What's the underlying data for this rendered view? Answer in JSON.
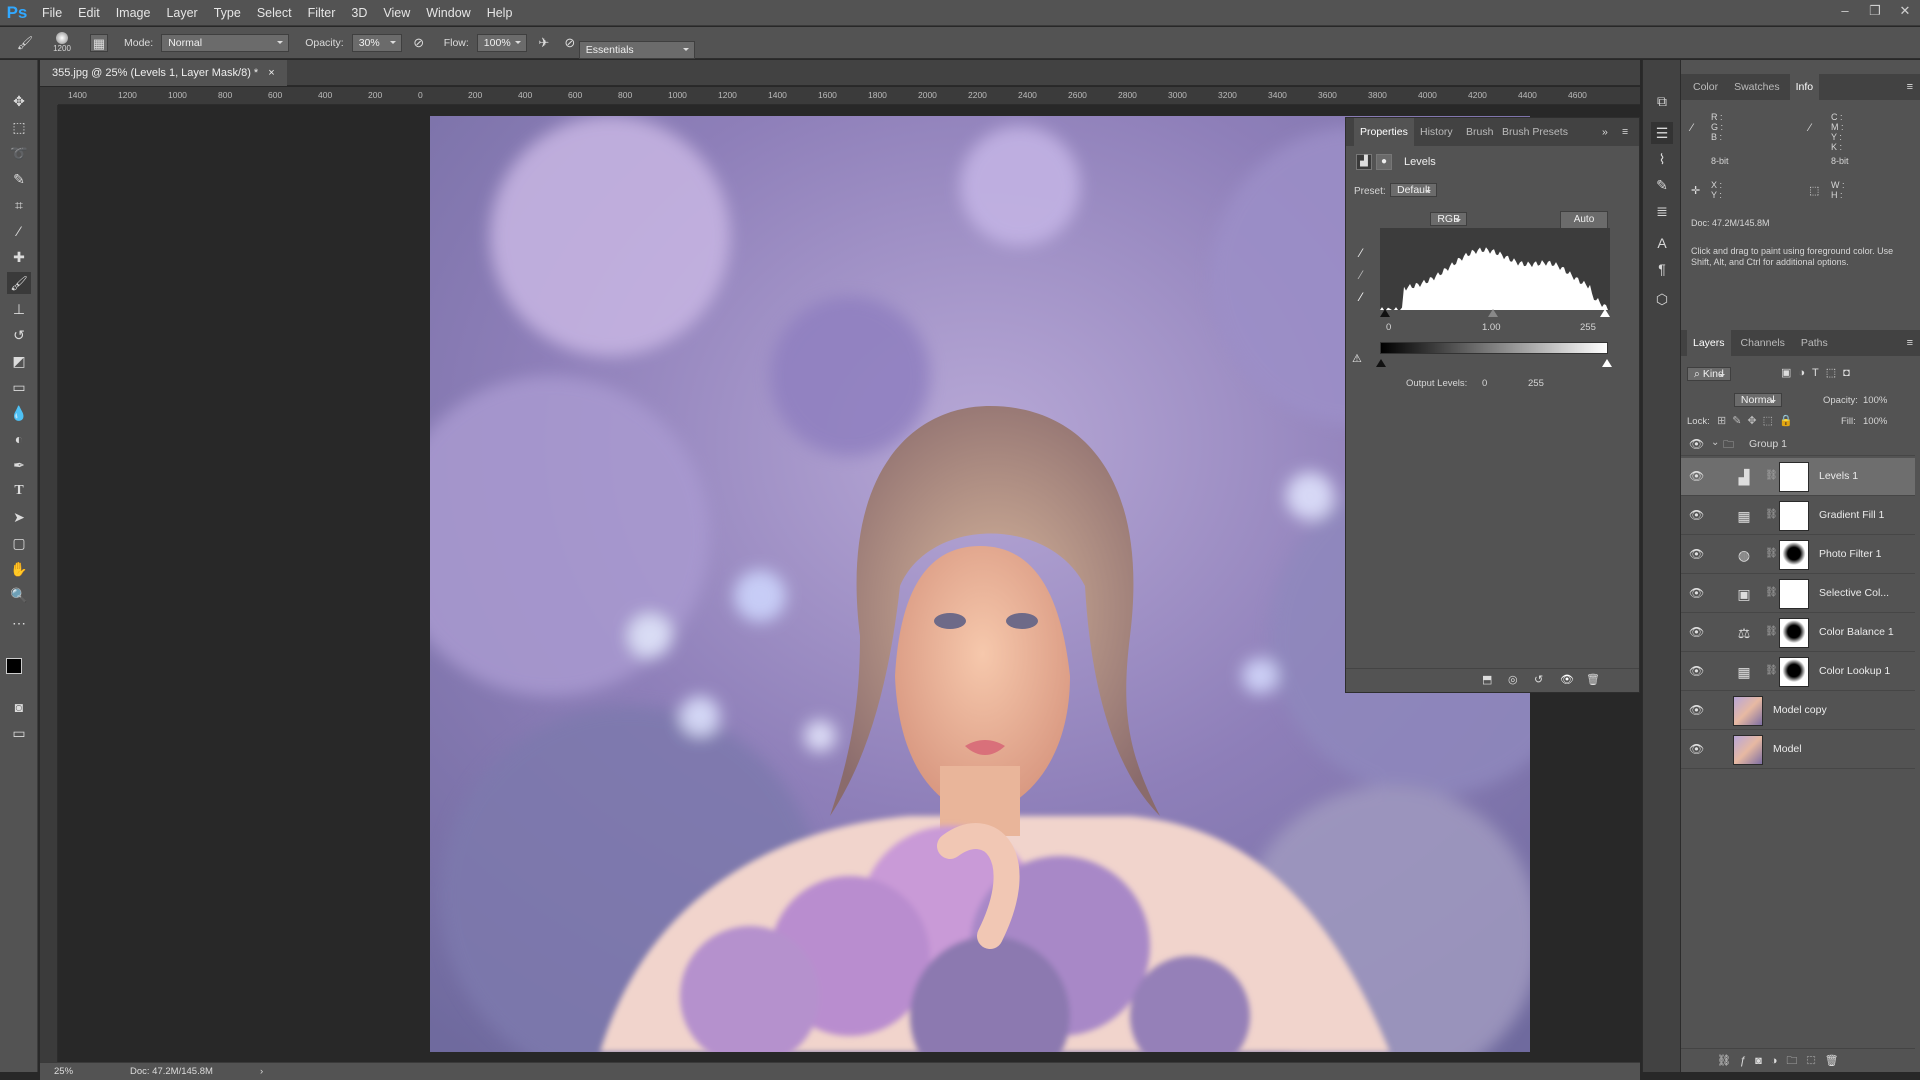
{
  "menubar": {
    "items": [
      "File",
      "Edit",
      "Image",
      "Layer",
      "Type",
      "Select",
      "Filter",
      "3D",
      "View",
      "Window",
      "Help"
    ]
  },
  "optbar": {
    "brush_size": "1200",
    "mode_label": "Mode:",
    "mode": "Normal",
    "opacity_label": "Opacity:",
    "opacity": "30%",
    "flow_label": "Flow:",
    "flow": "100%",
    "workspace": "Essentials"
  },
  "doctab": {
    "title": "355.jpg @ 25% (Levels 1, Layer Mask/8) *",
    "close": "×"
  },
  "ruler_h": [
    "1400",
    "1200",
    "1000",
    "800",
    "600",
    "400",
    "200",
    "0",
    "200",
    "400",
    "600",
    "800",
    "1000",
    "1200",
    "1400",
    "1600",
    "1800",
    "2000",
    "2200",
    "2400",
    "2600",
    "2800",
    "3000",
    "3200",
    "3400",
    "3600",
    "3800",
    "4000",
    "4200",
    "4400",
    "4600"
  ],
  "statusbar": {
    "zoom": "25%",
    "doc": "Doc: 47.2M/145.8M"
  },
  "properties": {
    "tabs": [
      "Properties",
      "History",
      "Brush",
      "Brush Presets"
    ],
    "title": "Levels",
    "preset_label": "Preset:",
    "preset": "Default",
    "channel": "RGB",
    "auto": "Auto",
    "input_black": "0",
    "input_gamma": "1.00",
    "input_white": "255",
    "output_label": "Output Levels:",
    "output_black": "0",
    "output_white": "255"
  },
  "info": {
    "tabs": [
      "Color",
      "Swatches",
      "Info"
    ],
    "rgb_labels": "R :\nG :\nB :",
    "bit_left": "8-bit",
    "cmyk_labels": "C :\nM :\nY :\nK :",
    "bit_right": "8-bit",
    "xy": "X :\nY :",
    "wh": "W :\nH :",
    "doc": "Doc: 47.2M/145.8M",
    "hint": "Click and drag to paint using foreground color. Use Shift, Alt, and Ctrl for additional options."
  },
  "layers": {
    "tabs": [
      "Layers",
      "Channels",
      "Paths"
    ],
    "kind": "Kind",
    "blend": "Normal",
    "opacity_label": "Opacity:",
    "opacity": "100%",
    "lock_label": "Lock:",
    "fill_label": "Fill:",
    "fill": "100%",
    "group": "Group 1",
    "items": [
      {
        "name": "Levels 1",
        "icon": "levels-icon"
      },
      {
        "name": "Gradient Fill 1",
        "icon": "gradient-icon"
      },
      {
        "name": "Photo Filter 1",
        "icon": "photo-filter-icon"
      },
      {
        "name": "Selective Col...",
        "icon": "selective-color-icon"
      },
      {
        "name": "Color Balance 1",
        "icon": "color-balance-icon"
      },
      {
        "name": "Color Lookup 1",
        "icon": "color-lookup-icon"
      },
      {
        "name": "Model copy",
        "icon": "image-icon"
      },
      {
        "name": "Model",
        "icon": "image-icon"
      }
    ]
  },
  "colors": {
    "ps_blue": "#31a8ff",
    "panel": "#535353",
    "dark": "#282828"
  }
}
